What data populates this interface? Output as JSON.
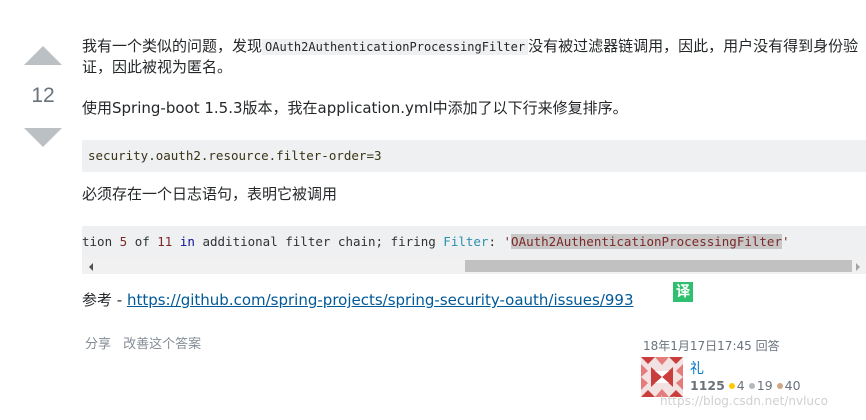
{
  "vote": {
    "count": "12",
    "up_icon": "triangle-up",
    "down_icon": "triangle-down"
  },
  "post": {
    "p1_before": "我有一个类似的问题，发现",
    "p1_code": "OAuth2AuthenticationProcessingFilter",
    "p1_after": "没有被过滤器链调用，因此，用户没有得到身份验证，因此被视为匿名。",
    "p2": "使用Spring-boot 1.5.3版本，我在application.yml中添加了以下行来修复排序。",
    "code1": "security.oauth2.resource.filter-order=3",
    "p3": "必须存在一个日志语句，表明它被调用",
    "code2": {
      "t1": "tion ",
      "n1": "5",
      "t2": " of ",
      "n2": "11",
      "t3": " ",
      "k1": "in",
      "t4": " additional filter chain; firing ",
      "typ": "Filter",
      "t5": ": ",
      "s1": "'",
      "hl": "OAuth2AuthenticationProcessingFilter",
      "s2": "'"
    },
    "p5_prefix": "参考 - ",
    "p5_link": "https://github.com/spring-projects/spring-security-oauth/issues/993",
    "translate_label": "译"
  },
  "actions": {
    "share": "分享",
    "improve": "改善这个答案"
  },
  "signature": {
    "answered": "18年1月17日17:45 回答",
    "user_name": "礼",
    "reputation": "1125",
    "gold": "4",
    "silver": "19",
    "bronze": "40"
  },
  "watermark": "https://blog.csdn.net/nvluco",
  "colors": {
    "link": "#005999",
    "translate": "#2fbf71",
    "code_bg": "#eff0f1"
  }
}
